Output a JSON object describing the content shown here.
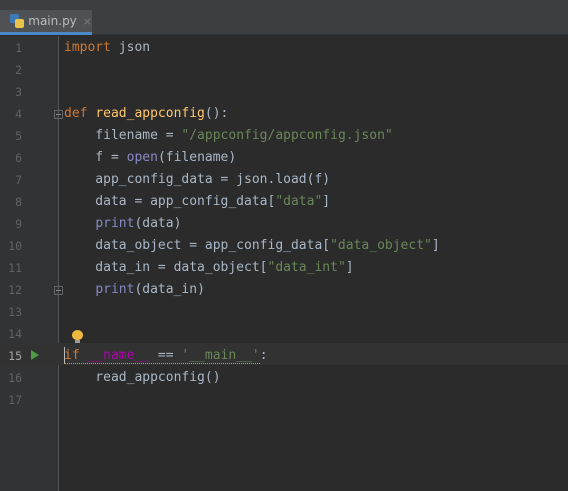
{
  "tab": {
    "filename": "main.py",
    "close_glyph": "×",
    "icon": "python-file-icon"
  },
  "current_line": 15,
  "line_numbers": [
    "1",
    "2",
    "3",
    "4",
    "5",
    "6",
    "7",
    "8",
    "9",
    "10",
    "11",
    "12",
    "13",
    "14",
    "15",
    "16",
    "17"
  ],
  "code": {
    "l1": {
      "kw": "import",
      "rest": " json"
    },
    "l4": {
      "kw": "def",
      "sp": " ",
      "fn": "read_appconfig",
      "rest": "():"
    },
    "l5": {
      "pre": "    filename = ",
      "str": "\"/appconfig/appconfig.json\""
    },
    "l6": {
      "pre": "    f = ",
      "bi": "open",
      "rest": "(filename)"
    },
    "l7": {
      "text": "    app_config_data = json.load(f)"
    },
    "l8": {
      "pre": "    data = app_config_data[",
      "str": "\"data\"",
      "rest": "]"
    },
    "l9": {
      "pre": "    ",
      "bi": "print",
      "rest": "(data)"
    },
    "l10": {
      "pre": "    data_object = app_config_data[",
      "str": "\"data_object\"",
      "rest": "]"
    },
    "l11": {
      "pre": "    data_in = data_object[",
      "str": "\"data_int\"",
      "rest": "]"
    },
    "l12": {
      "pre": "    ",
      "bi": "print",
      "rest": "(data_in)"
    },
    "l15": {
      "kw": "if",
      "sp1": " ",
      "magic": "__name__",
      "mid": " == ",
      "str": "'__main__'",
      "rest": ":"
    },
    "l16": {
      "text": "    read_appconfig()"
    }
  },
  "colors": {
    "keyword": "#cc7832",
    "function": "#ffc66d",
    "string": "#6a8759",
    "builtin": "#8888c6",
    "magic": "#b200b2",
    "default": "#a9b7c6"
  },
  "icons": [
    "run-icon",
    "lightbulb-icon",
    "fold-icon"
  ]
}
